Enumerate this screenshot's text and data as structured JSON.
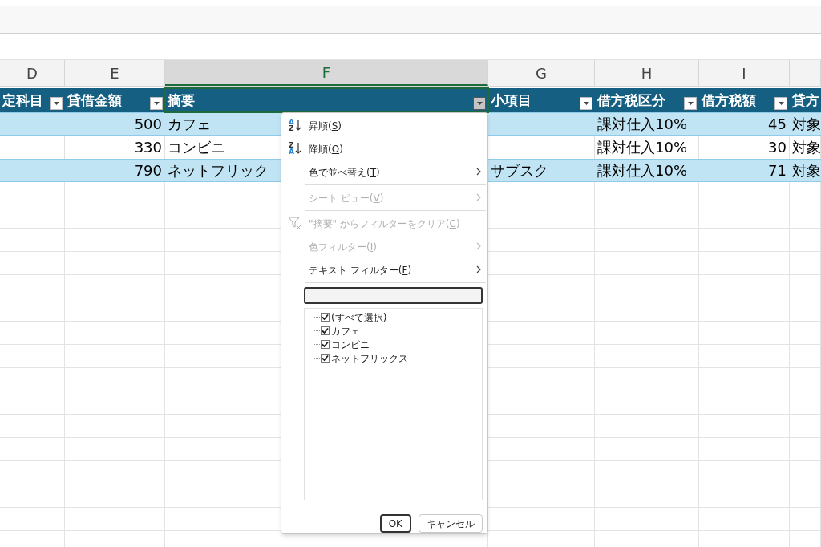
{
  "columns": [
    {
      "letter": "D",
      "selected": false,
      "kind": "text"
    },
    {
      "letter": "E",
      "selected": false,
      "kind": "number"
    },
    {
      "letter": "F",
      "selected": true,
      "kind": "text"
    },
    {
      "letter": "G",
      "selected": false,
      "kind": "text"
    },
    {
      "letter": "H",
      "selected": false,
      "kind": "text"
    },
    {
      "letter": "I",
      "selected": false,
      "kind": "number"
    },
    {
      "selected": false,
      "kind": "text"
    }
  ],
  "header_row": [
    {
      "label": "定科目",
      "filter": true,
      "filter_open": false
    },
    {
      "label": "貸借金額",
      "filter": true,
      "filter_open": false
    },
    {
      "label": "摘要",
      "filter": true,
      "filter_open": true
    },
    {
      "label": "小項目",
      "filter": true,
      "filter_open": false
    },
    {
      "label": "借方税区分",
      "filter": true,
      "filter_open": false
    },
    {
      "label": "借方税額",
      "filter": true,
      "filter_open": false
    },
    {
      "label": "貸方",
      "filter": false
    }
  ],
  "rows": [
    {
      "banded": true,
      "cells": [
        "",
        "500",
        "カフェ",
        "",
        "課対仕入10%",
        "45",
        "対象"
      ]
    },
    {
      "banded": false,
      "cells": [
        "",
        "330",
        "コンビニ",
        "",
        "課対仕入10%",
        "30",
        "対象"
      ]
    },
    {
      "banded": true,
      "cells": [
        "",
        "790",
        "ネットフリック",
        "サブスク",
        "課対仕入10%",
        "71",
        "対象"
      ]
    }
  ],
  "filter_menu": {
    "items": [
      {
        "kind": "sort_asc",
        "icon_top": "A",
        "icon_bottom": "Z",
        "label": "昇順(",
        "accel": "S",
        "tail": ")",
        "disabled": false,
        "submenu": false
      },
      {
        "kind": "sort_desc",
        "icon_top": "Z",
        "icon_bottom": "A",
        "label": "降順(",
        "accel": "O",
        "tail": ")",
        "disabled": false,
        "submenu": false
      },
      {
        "kind": "plain",
        "label": "色で並べ替え(",
        "accel": "T",
        "tail": ")",
        "disabled": false,
        "submenu": true
      },
      {
        "kind": "separator"
      },
      {
        "kind": "plain",
        "label": "シート ビュー(",
        "accel": "V",
        "tail": ")",
        "disabled": true,
        "submenu": true
      },
      {
        "kind": "separator"
      },
      {
        "kind": "clear_filter",
        "label": "\"摘要\" からフィルターをクリア(",
        "accel": "C",
        "tail": ")",
        "disabled": true,
        "submenu": false
      },
      {
        "kind": "plain",
        "label": "色フィルター(",
        "accel": "I",
        "tail": ")",
        "disabled": true,
        "submenu": true
      },
      {
        "kind": "plain",
        "label": "テキスト フィルター(",
        "accel": "F",
        "tail": ")",
        "disabled": false,
        "submenu": true
      },
      {
        "kind": "separator"
      }
    ],
    "values": [
      {
        "label": "(すべて選択)",
        "checked": true
      },
      {
        "label": "カフェ",
        "checked": true
      },
      {
        "label": "コンビニ",
        "checked": true
      },
      {
        "label": "ネットフリックス",
        "checked": true
      }
    ],
    "buttons": [
      {
        "label": "OK",
        "default": true
      },
      {
        "label": "キャンセル",
        "default": false
      }
    ]
  }
}
